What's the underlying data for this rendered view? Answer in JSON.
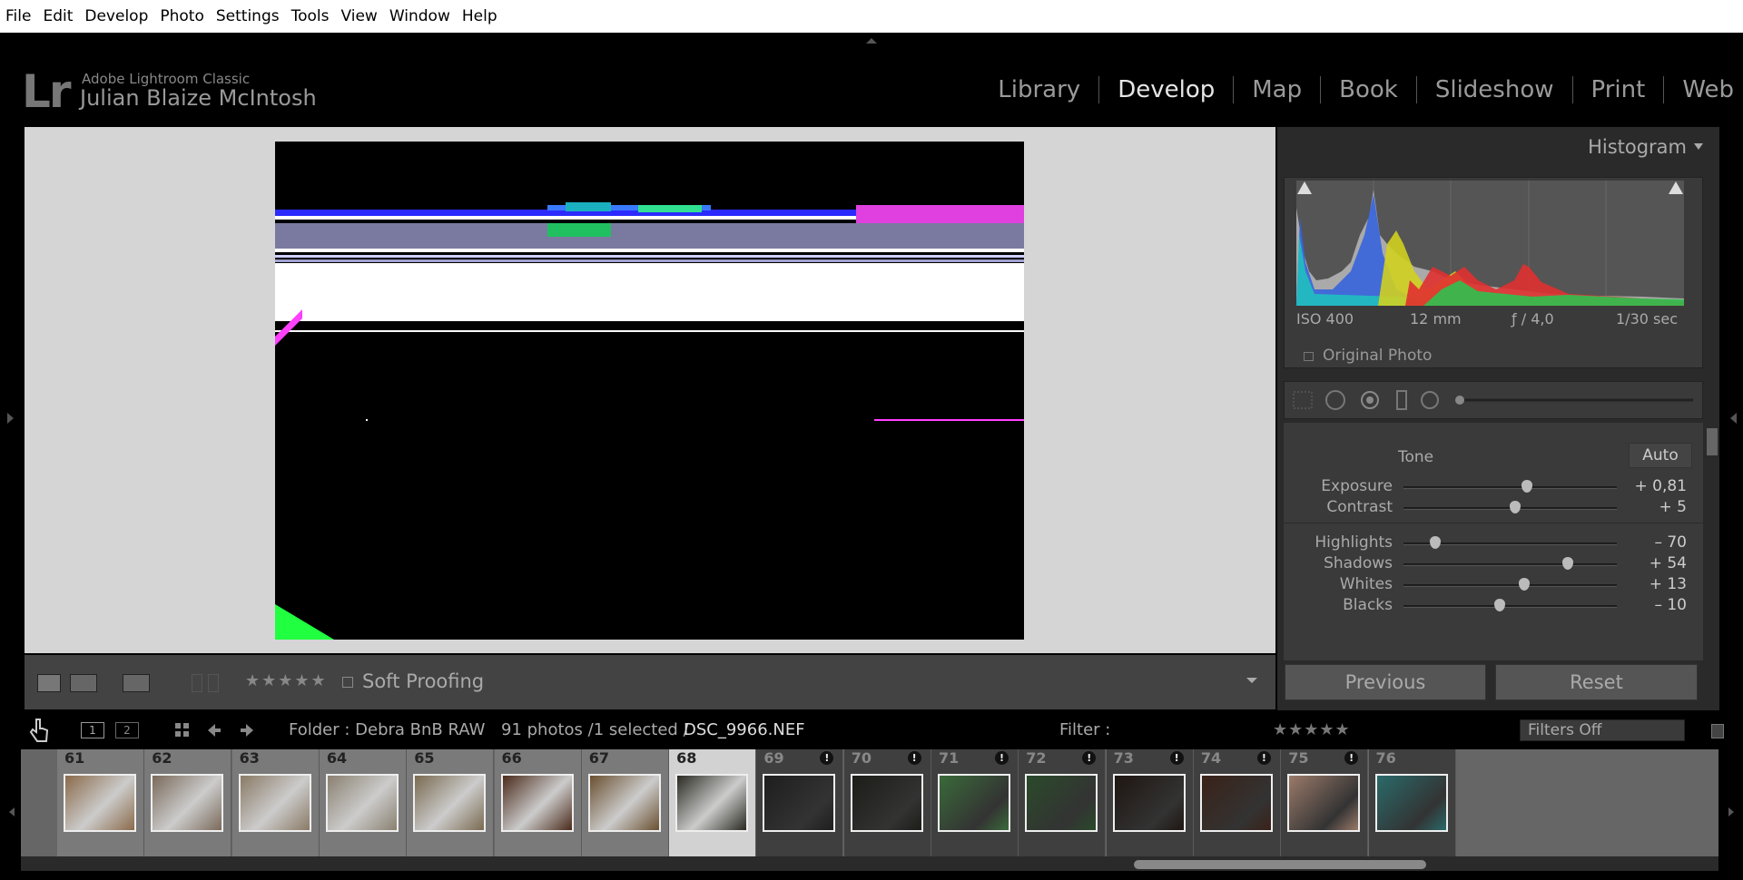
{
  "menu": [
    "File",
    "Edit",
    "Develop",
    "Photo",
    "Settings",
    "Tools",
    "View",
    "Window",
    "Help"
  ],
  "identity": {
    "logo": "Lr",
    "product": "Adobe Lightroom Classic",
    "user": "Julian Blaize McIntosh"
  },
  "modules": [
    "Library",
    "Develop",
    "Map",
    "Book",
    "Slideshow",
    "Print",
    "Web"
  ],
  "active_module": "Develop",
  "histogram": {
    "title": "Histogram",
    "iso": "ISO 400",
    "focal": "12 mm",
    "aperture": "ƒ / 4,0",
    "shutter": "1/30 sec",
    "original_photo": "Original Photo"
  },
  "tone": {
    "heading": "Tone",
    "auto": "Auto",
    "sliders": [
      {
        "label": "Exposure",
        "value": "+ 0,81",
        "level": 0.58
      },
      {
        "label": "Contrast",
        "value": "+ 5",
        "level": 0.525
      },
      {
        "label": "Highlights",
        "value": "– 70",
        "level": 0.15
      },
      {
        "label": "Shadows",
        "value": "+ 54",
        "level": 0.77
      },
      {
        "label": "Whites",
        "value": "+ 13",
        "level": 0.565
      },
      {
        "label": "Blacks",
        "value": "– 10",
        "level": 0.45
      }
    ]
  },
  "buttons": {
    "previous": "Previous",
    "reset": "Reset"
  },
  "toolbar": {
    "soft_proofing": "Soft Proofing",
    "stars": "★★★★★"
  },
  "filmbar": {
    "folder": "Folder : Debra BnB RAW",
    "count": "91 photos /1 selected /",
    "filename": "DSC_9966.NEF",
    "filter_label": "Filter :",
    "filter_stars": "★★★★★",
    "filters_off": "Filters Off"
  },
  "filmstrip": [
    {
      "num": "61",
      "tone": "#8a6a4a",
      "badge": false
    },
    {
      "num": "62",
      "tone": "#7a6a5a",
      "badge": false
    },
    {
      "num": "63",
      "tone": "#8a7a66",
      "badge": false
    },
    {
      "num": "64",
      "tone": "#8a8070",
      "badge": false
    },
    {
      "num": "65",
      "tone": "#7a6a50",
      "badge": false
    },
    {
      "num": "66",
      "tone": "#4a2a1a",
      "badge": false
    },
    {
      "num": "67",
      "tone": "#6a5030",
      "badge": false
    },
    {
      "num": "68",
      "tone": "#2a2a22",
      "badge": false,
      "selected": true
    },
    {
      "num": "69",
      "tone": "#1e1e1e",
      "badge": true,
      "dim": true
    },
    {
      "num": "70",
      "tone": "#1c1c18",
      "badge": true,
      "dim": true
    },
    {
      "num": "71",
      "tone": "#3a6a3a",
      "badge": true,
      "dim": true
    },
    {
      "num": "72",
      "tone": "#2a4a2a",
      "badge": true,
      "dim": true
    },
    {
      "num": "73",
      "tone": "#1e1612",
      "badge": true,
      "dim": true
    },
    {
      "num": "74",
      "tone": "#3a2218",
      "badge": true,
      "dim": true
    },
    {
      "num": "75",
      "tone": "#9a7a6a",
      "badge": true,
      "dim": true
    },
    {
      "num": "76",
      "tone": "#2a6a6a",
      "badge": false,
      "dim": true
    }
  ]
}
